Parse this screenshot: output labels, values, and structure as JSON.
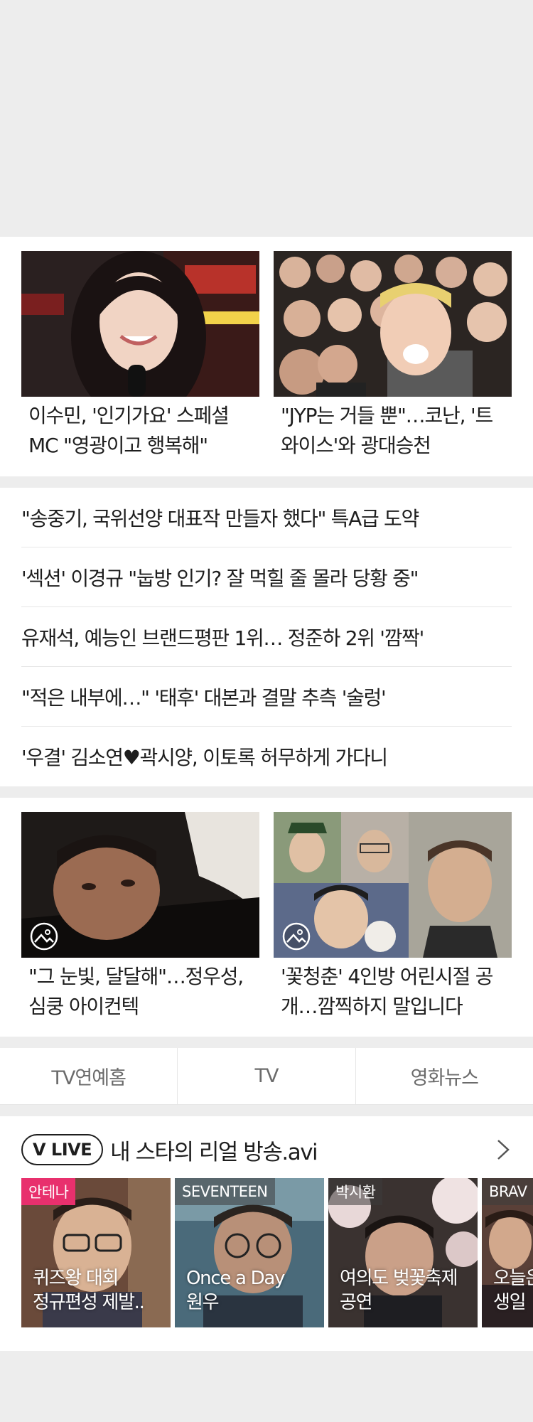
{
  "featured_top": [
    {
      "caption_line1": "이수민, '인기가요' 스페셜",
      "caption_line2": "MC \"영광이고 행복해\""
    },
    {
      "caption_line1": "\"JYP는 거들 뿐\"…코난, '트",
      "caption_line2": "와이스'와 광대승천"
    }
  ],
  "headlines": [
    "\"송중기, 국위선양 대표작 만들자 했다\" 특A급 도약",
    "'섹션' 이경규 \"눕방 인기? 잘 먹힐 줄 몰라 당황 중\"",
    "유재석, 예능인 브랜드평판 1위… 정준하 2위 '깜짝'",
    "\"적은 내부에…\" '태후' 대본과 결말 추측 '술렁'",
    "'우결' 김소연♥곽시양, 이토록 허무하게 가다니"
  ],
  "featured_bottom": [
    {
      "caption_line1": "\"그 눈빛, 달달해\"…정우성,",
      "caption_line2": "심쿵 아이컨텍",
      "icon": "gallery-icon"
    },
    {
      "caption_line1": "'꽃청춘' 4인방 어린시절 공",
      "caption_line2": "개…깜찍하지 말입니다",
      "icon": "gallery-icon"
    }
  ],
  "tabs": [
    "TV연예홈",
    "TV",
    "영화뉴스"
  ],
  "vlive": {
    "logo": "V LIVE",
    "title": "내 스타의 리얼 방송.avi",
    "clips": [
      {
        "tag": "안테나",
        "line1": "퀴즈왕 대회",
        "line2": "정규편성 제발.."
      },
      {
        "tag": "SEVENTEEN",
        "line1": "Once a Day",
        "line2": "원우"
      },
      {
        "tag": "박시환",
        "line1": "여의도 벚꽃축제",
        "line2": "공연"
      },
      {
        "tag": "BRAV",
        "line1": "오늘은",
        "line2": "생일"
      }
    ]
  },
  "colors": {
    "accent_pink": "#e8306d",
    "text": "#1e1e1e",
    "muted": "#6b6b6b",
    "bg": "#ededed"
  }
}
